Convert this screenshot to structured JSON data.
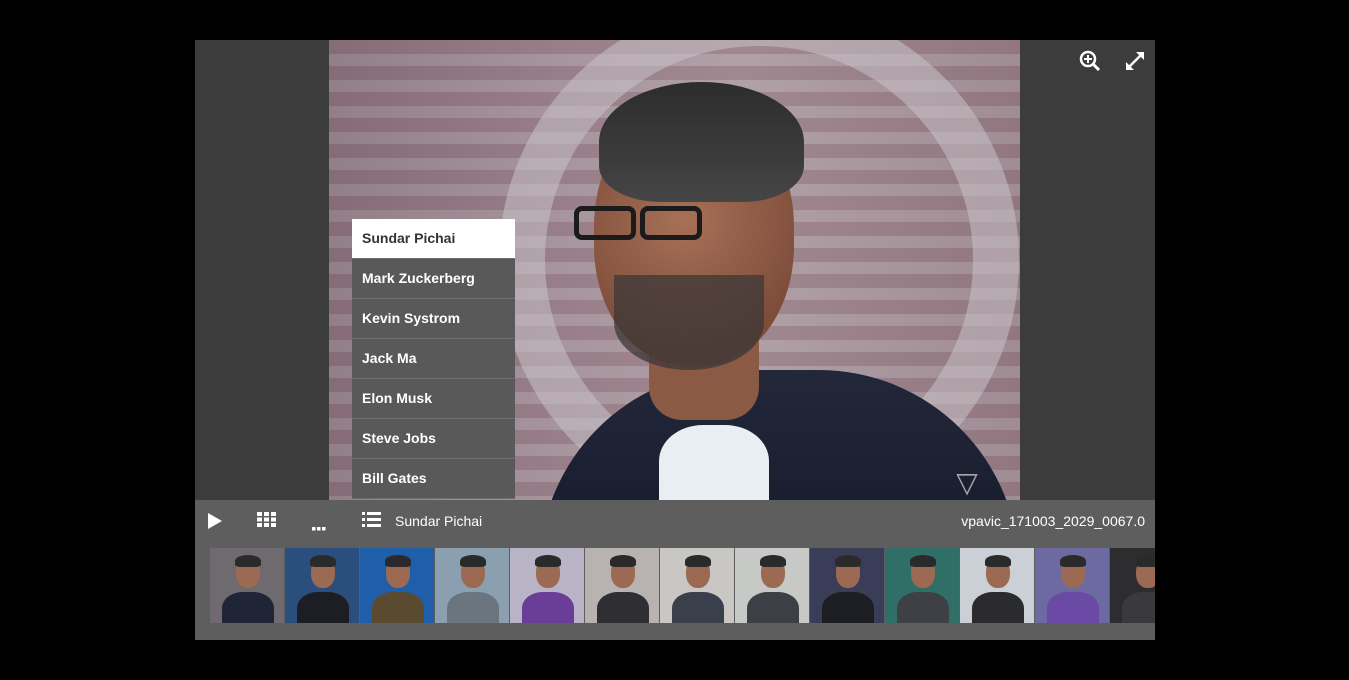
{
  "viewer": {
    "icons": {
      "zoom": "zoom-in-icon",
      "fullscreen": "fullscreen-icon"
    }
  },
  "menu": {
    "items": [
      {
        "label": "Sundar Pichai",
        "active": true
      },
      {
        "label": "Mark Zuckerberg"
      },
      {
        "label": "Kevin Systrom"
      },
      {
        "label": "Jack Ma"
      },
      {
        "label": "Elon Musk"
      },
      {
        "label": "Steve Jobs"
      },
      {
        "label": "Bill Gates"
      }
    ]
  },
  "toolbar": {
    "icons": {
      "play": "play-icon",
      "grid": "grid-icon",
      "dots": "more-icon",
      "list": "list-icon"
    },
    "caption": "Sundar Pichai",
    "filename": "vpavic_171003_2029_0067.0"
  },
  "thumbnails": [
    {
      "bg": "#6f6a70",
      "body": "#1f2436"
    },
    {
      "bg": "#2a4e7e",
      "body": "#1d1d24"
    },
    {
      "bg": "#1f5ea8",
      "body": "#5a4a30"
    },
    {
      "bg": "#8aa0b0",
      "body": "#6b7580"
    },
    {
      "bg": "#b9b3c6",
      "body": "#6a3d96"
    },
    {
      "bg": "#b8b2b0",
      "body": "#2e2e33"
    },
    {
      "bg": "#c9c7c4",
      "body": "#3a3f4c"
    },
    {
      "bg": "#c7c9c6",
      "body": "#3d3f46"
    },
    {
      "bg": "#3a3d57",
      "body": "#1d1d24"
    },
    {
      "bg": "#2f6f68",
      "body": "#3d4045"
    },
    {
      "bg": "#cbcfd6",
      "body": "#2b2b2e"
    },
    {
      "bg": "#6c6aa0",
      "body": "#6a4aa4"
    },
    {
      "bg": "#2d2d30",
      "body": "#3a3a3e"
    }
  ]
}
